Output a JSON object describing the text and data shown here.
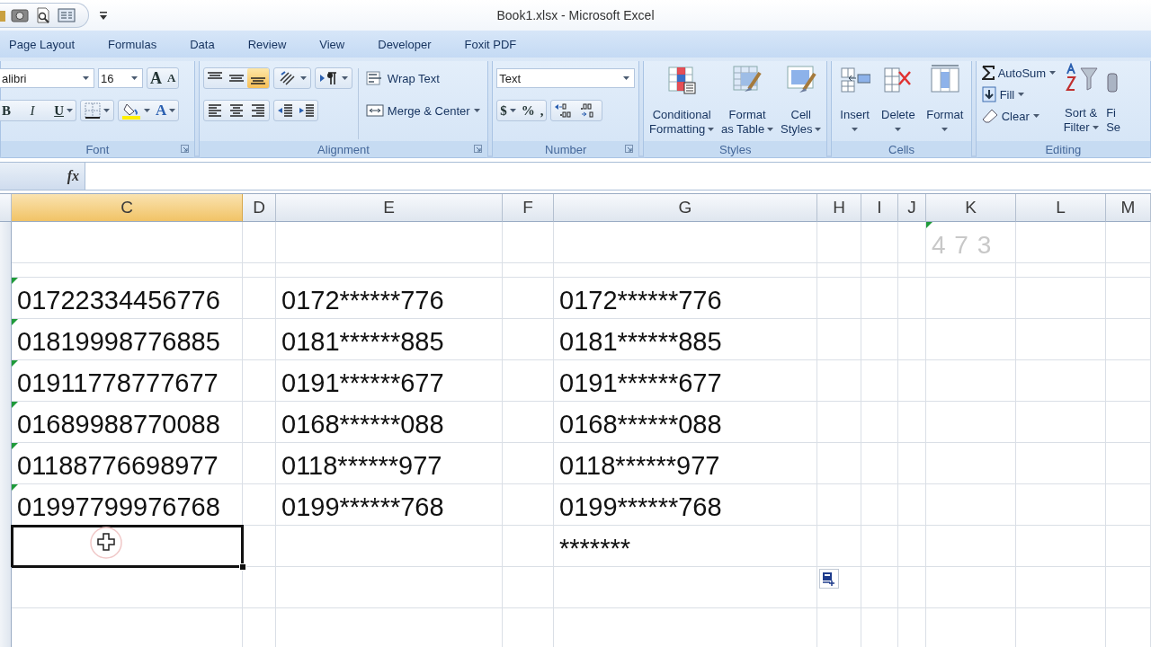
{
  "window": {
    "title": "Book1.xlsx - Microsoft Excel"
  },
  "tabs": [
    {
      "label": "Page Layout",
      "selected": false
    },
    {
      "label": "Formulas",
      "selected": false
    },
    {
      "label": "Data",
      "selected": false
    },
    {
      "label": "Review",
      "selected": false
    },
    {
      "label": "View",
      "selected": false
    },
    {
      "label": "Developer",
      "selected": false
    },
    {
      "label": "Foxit PDF",
      "selected": false
    }
  ],
  "ribbon": {
    "font": {
      "label": "Font",
      "font_name": "alibri",
      "font_size": "16",
      "grow": "A",
      "shrink": "A",
      "bold": "B",
      "italic": "I",
      "underline": "U",
      "font_color": "A"
    },
    "alignment": {
      "label": "Alignment",
      "vertical": [
        {
          "selected": false
        },
        {
          "selected": false
        },
        {
          "selected": true
        }
      ],
      "wrap_text": "Wrap Text",
      "merge": "Merge & Center"
    },
    "number": {
      "label": "Number",
      "format": "Text",
      "currency": "$",
      "percent": "%",
      "comma": ","
    },
    "styles": {
      "label": "Styles",
      "buttons": [
        {
          "lines": [
            "Conditional",
            "Formatting"
          ]
        },
        {
          "lines": [
            "Format",
            "as Table"
          ]
        },
        {
          "lines": [
            "Cell",
            "Styles"
          ]
        }
      ]
    },
    "cells": {
      "label": "Cells",
      "buttons": [
        "Insert",
        "Delete",
        "Format"
      ]
    },
    "editing": {
      "label": "Editing",
      "autosum": "AutoSum",
      "fill": "Fill",
      "clear": "Clear",
      "sort": [
        "Sort &",
        "Filter"
      ],
      "find": [
        "Fi",
        "Se"
      ]
    }
  },
  "formula_bar": {
    "fx": "fx"
  },
  "sheet": {
    "columns": [
      {
        "label": "C",
        "selected": true
      },
      {
        "label": "D",
        "selected": false
      },
      {
        "label": "E",
        "selected": false
      },
      {
        "label": "F",
        "selected": false
      },
      {
        "label": "G",
        "selected": false
      },
      {
        "label": "H",
        "selected": false
      },
      {
        "label": "I",
        "selected": false
      },
      {
        "label": "J",
        "selected": false
      },
      {
        "label": "K",
        "selected": false
      },
      {
        "label": "L",
        "selected": false
      },
      {
        "label": "M",
        "selected": false
      }
    ],
    "rows": [
      {
        "kind": "normal",
        "k": {
          "text": "4 7 3",
          "faded": true,
          "error_flag": true
        }
      },
      {
        "kind": "short"
      },
      {
        "kind": "normal",
        "c": {
          "text": "01722334456776",
          "error_flag": true
        },
        "e": {
          "text": "0172******776"
        },
        "g": {
          "text": "0172******776"
        }
      },
      {
        "kind": "normal",
        "c": {
          "text": "01819998776885",
          "error_flag": true
        },
        "e": {
          "text": "0181******885"
        },
        "g": {
          "text": "0181******885"
        }
      },
      {
        "kind": "normal",
        "c": {
          "text": "01911778777677",
          "error_flag": true
        },
        "e": {
          "text": "0191******677"
        },
        "g": {
          "text": "0191******677"
        }
      },
      {
        "kind": "normal",
        "c": {
          "text": "01689988770088",
          "error_flag": true
        },
        "e": {
          "text": "0168******088"
        },
        "g": {
          "text": "0168******088"
        }
      },
      {
        "kind": "normal",
        "c": {
          "text": "01188776698977",
          "error_flag": true
        },
        "e": {
          "text": "0118******977"
        },
        "g": {
          "text": "0118******977"
        }
      },
      {
        "kind": "normal",
        "c": {
          "text": "01997799976768",
          "error_flag": true
        },
        "e": {
          "text": "0199******768"
        },
        "g": {
          "text": "0199******768"
        }
      },
      {
        "kind": "normal",
        "c": {
          "selected": true
        },
        "g": {
          "text": "*******"
        }
      },
      {
        "kind": "normal"
      },
      {
        "kind": "normal"
      }
    ]
  }
}
